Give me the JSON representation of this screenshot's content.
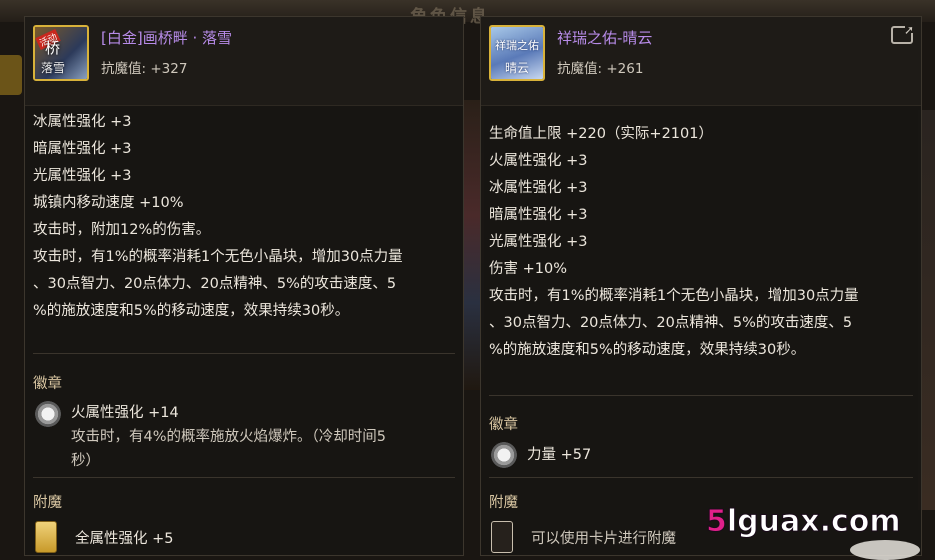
{
  "background": {
    "title": "角色信息"
  },
  "left": {
    "item_name": "[白金]画桥畔 · 落雪",
    "resist": "抗魔值: +327",
    "icon_badge": "活动",
    "icon_glyph_1": "桥",
    "icon_glyph_2": "落雪",
    "lines": [
      "冰属性强化 +3",
      "暗属性强化 +3",
      "光属性强化 +3",
      "城镇内移动速度 +10%",
      "攻击时，附加12%的伤害。",
      "攻击时，有1%的概率消耗1个无色小晶块，增加30点力量",
      "、30点智力、20点体力、20点精神、5%的攻击速度、5",
      "%的施放速度和5%的移动速度，效果持续30秒。"
    ],
    "emblem_title": "徽章",
    "emblem_stat": "火属性强化 +14",
    "emblem_desc_1": "攻击时，有4%的概率施放火焰爆炸。（冷却时间5",
    "emblem_desc_2": "秒）",
    "enchant_title": "附魔",
    "enchant_text": "全属性强化 +5"
  },
  "right": {
    "item_name": "祥瑞之佑-晴云",
    "resist": "抗魔值: +261",
    "icon_glyph_1": "祥瑞之佑",
    "icon_glyph_2": "晴云",
    "lines": [
      "生命值上限 +220（实际+2101）",
      "火属性强化 +3",
      "冰属性强化 +3",
      "暗属性强化 +3",
      "光属性强化 +3",
      "伤害 +10%",
      "攻击时，有1%的概率消耗1个无色小晶块，增加30点力量",
      "、30点智力、20点体力、20点精神、5%的攻击速度、5",
      "%的施放速度和5%的移动速度，效果持续30秒。"
    ],
    "emblem_title": "徽章",
    "emblem_stat": "力量 +57",
    "enchant_title": "附魔",
    "enchant_text": "可以使用卡片进行附魔"
  },
  "watermark": {
    "prefix": "5",
    "rest": "lguax.com"
  },
  "colors": {
    "item_name": "#b78be8",
    "icon_border": "#d8b23a",
    "section_title": "#d9c6a2",
    "watermark_accent": "#e0208a"
  }
}
